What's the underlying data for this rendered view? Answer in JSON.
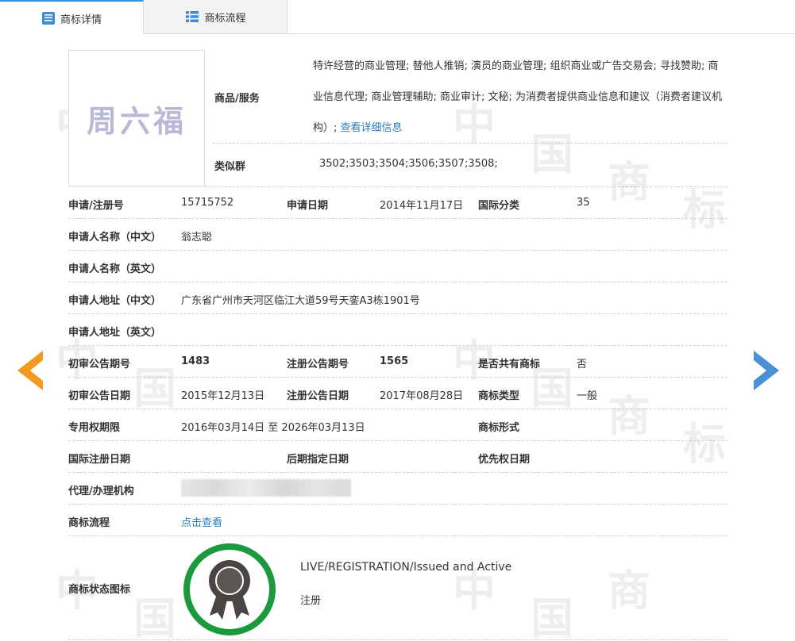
{
  "tabs": [
    {
      "label": "商标详情",
      "active": true
    },
    {
      "label": "商标流程",
      "active": false
    }
  ],
  "logo": {
    "text": "周六福"
  },
  "watermark": [
    "中",
    "国",
    "商",
    "标"
  ],
  "goods": {
    "label": "商品/服务",
    "text": "特许经营的商业管理; 替他人推销; 演员的商业管理; 组织商业或广告交易会; 寻找赞助; 商业信息代理; 商业管理辅助; 商业审计; 文秘; 为消费者提供商业信息和建议（消费者建议机构）;",
    "link": "查看详细信息"
  },
  "similar": {
    "label": "类似群",
    "value": "3502;3503;3504;3506;3507;3508;"
  },
  "fields": {
    "reg_no_label": "申请/注册号",
    "reg_no": "15715752",
    "apply_date_label": "申请日期",
    "apply_date": "2014年11月17日",
    "intl_class_label": "国际分类",
    "intl_class": "35",
    "applicant_cn_label": "申请人名称（中文）",
    "applicant_cn": "翁志聪",
    "applicant_en_label": "申请人名称（英文）",
    "applicant_en": "",
    "address_cn_label": "申请人地址（中文）",
    "address_cn": "广东省广州市天河区临江大道59号天銮A3栋1901号",
    "address_en_label": "申请人地址（英文）",
    "address_en": "",
    "prelim_no_label": "初审公告期号",
    "prelim_no": "1483",
    "reg_pub_no_label": "注册公告期号",
    "reg_pub_no": "1565",
    "shared_label": "是否共有商标",
    "shared": "否",
    "prelim_date_label": "初审公告日期",
    "prelim_date": "2015年12月13日",
    "reg_pub_date_label": "注册公告日期",
    "reg_pub_date": "2017年08月28日",
    "mark_type_label": "商标类型",
    "mark_type": "一般",
    "exclusive_label": "专用权期限",
    "exclusive": "2016年03月14日 至 2026年03月13日",
    "mark_form_label": "商标形式",
    "mark_form": "",
    "intl_reg_date_label": "国际注册日期",
    "intl_reg_date": "",
    "later_date_label": "后期指定日期",
    "later_date": "",
    "priority_date_label": "优先权日期",
    "priority_date": "",
    "agent_label": "代理/办理机构",
    "flow_label": "商标流程",
    "flow_link": "点击查看"
  },
  "status": {
    "label": "商标状态图标",
    "en": "LIVE/REGISTRATION/Issued and Active",
    "cn": "注册",
    "ring_color": "#1a9a3c"
  },
  "colors": {
    "accent": "#3a8fd6",
    "prev_arrow": "#f39a1e",
    "next_arrow": "#4a90d9",
    "link": "#2a7cc7"
  }
}
